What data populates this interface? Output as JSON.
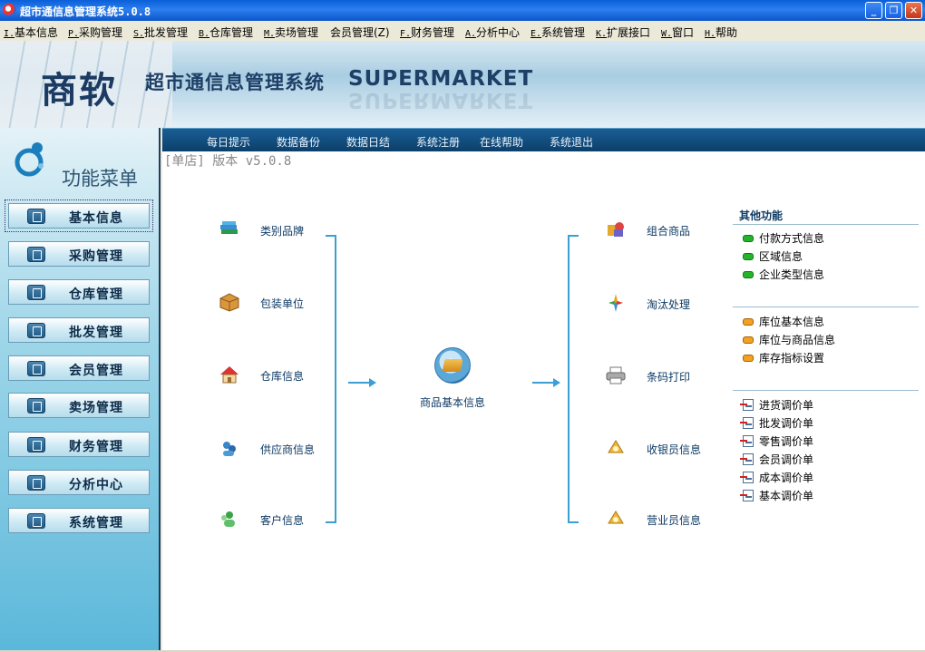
{
  "window": {
    "title": "超市通信息管理系统5.0.8",
    "minimize": "_",
    "restore": "❐",
    "close": "✕"
  },
  "menu": [
    {
      "key": "I.",
      "label": "基本信息"
    },
    {
      "key": "P.",
      "label": "采购管理"
    },
    {
      "key": "S.",
      "label": "批发管理"
    },
    {
      "key": "B.",
      "label": "仓库管理"
    },
    {
      "key": "M.",
      "label": "卖场管理"
    },
    {
      "key": "",
      "label": "会员管理(Z)"
    },
    {
      "key": "F.",
      "label": "财务管理"
    },
    {
      "key": "A.",
      "label": "分析中心"
    },
    {
      "key": "E.",
      "label": "系统管理"
    },
    {
      "key": "K.",
      "label": "扩展接口"
    },
    {
      "key": "W.",
      "label": "窗口"
    },
    {
      "key": "H.",
      "label": "帮助"
    }
  ],
  "banner": {
    "logo": "商软",
    "title": "超市通信息管理系统",
    "subtitle": "SUPERMARKET"
  },
  "sidebar": {
    "title": "功能菜单",
    "items": [
      {
        "label": "基本信息",
        "icon": "document-icon"
      },
      {
        "label": "采购管理",
        "icon": "cart-icon"
      },
      {
        "label": "仓库管理",
        "icon": "warehouse-icon"
      },
      {
        "label": "批发管理",
        "icon": "truck-icon"
      },
      {
        "label": "会员管理",
        "icon": "member-card-icon"
      },
      {
        "label": "卖场管理",
        "icon": "refresh-icon"
      },
      {
        "label": "财务管理",
        "icon": "folder-icon"
      },
      {
        "label": "分析中心",
        "icon": "calculator-icon"
      },
      {
        "label": "系统管理",
        "icon": "gears-icon"
      }
    ]
  },
  "toolbar": [
    "每日提示",
    "数据备份",
    "数据日结",
    "系统注册",
    "在线帮助",
    "系统退出"
  ],
  "main": {
    "version": "[单店] 版本 v5.0.8",
    "left_nodes": [
      {
        "label": "类别品牌",
        "icon": "books-icon"
      },
      {
        "label": "包装单位",
        "icon": "box-icon"
      },
      {
        "label": "仓库信息",
        "icon": "house-icon"
      },
      {
        "label": "供应商信息",
        "icon": "supplier-icon"
      },
      {
        "label": "客户信息",
        "icon": "customer-icon"
      }
    ],
    "center": {
      "label": "商品基本信息",
      "icon": "product-info-icon"
    },
    "right_nodes": [
      {
        "label": "组合商品",
        "icon": "combo-icon"
      },
      {
        "label": "淘汰处理",
        "icon": "discard-icon"
      },
      {
        "label": "条码打印",
        "icon": "printer-icon"
      },
      {
        "label": "收银员信息",
        "icon": "cashier-icon"
      },
      {
        "label": "营业员信息",
        "icon": "clerk-icon"
      }
    ]
  },
  "other": {
    "title": "其他功能",
    "group1": [
      "付款方式信息",
      "区域信息",
      "企业类型信息"
    ],
    "group2": [
      "库位基本信息",
      "库位与商品信息",
      "库存指标设置"
    ],
    "group3": [
      "进货调价单",
      "批发调价单",
      "零售调价单",
      "会员调价单",
      "成本调价单",
      "基本调价单"
    ]
  }
}
